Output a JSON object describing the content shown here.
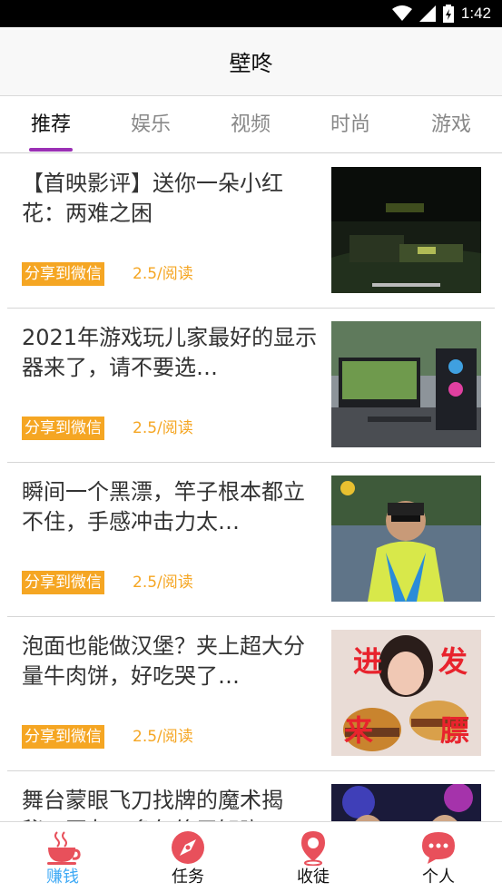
{
  "status_bar": {
    "time": "1:42"
  },
  "header": {
    "title": "壁咚"
  },
  "tabs": [
    {
      "label": "推荐"
    },
    {
      "label": "娱乐"
    },
    {
      "label": "视频"
    },
    {
      "label": "时尚"
    },
    {
      "label": "游戏"
    }
  ],
  "feed": {
    "items": [
      {
        "title": "【首映影评】送你一朵小红花：两难之困",
        "share_label": "分享到微信",
        "read_count": "2.5/阅读"
      },
      {
        "title": "2021年游戏玩儿家最好的显示器来了，请不要选…",
        "share_label": "分享到微信",
        "read_count": "2.5/阅读"
      },
      {
        "title": "瞬间一个黑漂，竿子根本都立不住，手感冲击力太…",
        "share_label": "分享到微信",
        "read_count": "2.5/阅读"
      },
      {
        "title": "泡面也能做汉堡？夹上超大分量牛肉饼，好吃哭了…",
        "share_label": "分享到微信",
        "read_count": "2.5/阅读",
        "thumb_text": [
          "进",
          "发",
          "来",
          "膘"
        ]
      },
      {
        "title": "舞台蒙眼飞刀找牌的魔术揭秘，网友：多年终于知晓"
      }
    ]
  },
  "bottom_nav": {
    "items": [
      {
        "label": "赚钱",
        "icon": "cup-icon"
      },
      {
        "label": "任务",
        "icon": "compass-icon"
      },
      {
        "label": "收徒",
        "icon": "location-pin-icon"
      },
      {
        "label": "个人",
        "icon": "chat-bubble-icon"
      }
    ]
  },
  "colors": {
    "accent_purple": "#9b30b5",
    "tag_orange": "#f5a623",
    "nav_active": "#3ea9f5",
    "nav_icon": "#e8505b"
  }
}
